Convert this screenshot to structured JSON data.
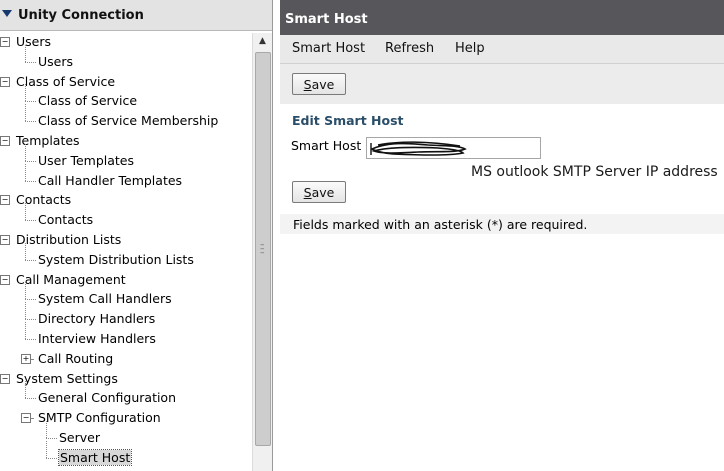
{
  "nav": {
    "title": "Unity Connection",
    "tree": [
      {
        "label": "Users",
        "level": 0,
        "expander": "-"
      },
      {
        "label": "Users",
        "level": 1
      },
      {
        "label": "Class of Service",
        "level": 0,
        "expander": "-"
      },
      {
        "label": "Class of Service",
        "level": 1
      },
      {
        "label": "Class of Service Membership",
        "level": 1
      },
      {
        "label": "Templates",
        "level": 0,
        "expander": "-"
      },
      {
        "label": "User Templates",
        "level": 1
      },
      {
        "label": "Call Handler Templates",
        "level": 1
      },
      {
        "label": "Contacts",
        "level": 0,
        "expander": "-"
      },
      {
        "label": "Contacts",
        "level": 1
      },
      {
        "label": "Distribution Lists",
        "level": 0,
        "expander": "-"
      },
      {
        "label": "System Distribution Lists",
        "level": 1
      },
      {
        "label": "Call Management",
        "level": 0,
        "expander": "-"
      },
      {
        "label": "System Call Handlers",
        "level": 1
      },
      {
        "label": "Directory Handlers",
        "level": 1
      },
      {
        "label": "Interview Handlers",
        "level": 1
      },
      {
        "label": "Call Routing",
        "level": 1,
        "expander": "+"
      },
      {
        "label": "System Settings",
        "level": 0,
        "expander": "-"
      },
      {
        "label": "General Configuration",
        "level": 1
      },
      {
        "label": "SMTP Configuration",
        "level": 1,
        "expander": "-"
      },
      {
        "label": "Server",
        "level": 2
      },
      {
        "label": "Smart Host",
        "level": 2,
        "selected": true
      }
    ]
  },
  "page": {
    "title": "Smart Host",
    "menu": [
      "Smart Host",
      "Refresh",
      "Help"
    ],
    "save_label_pre": "",
    "save_label_u": "S",
    "save_label_post": "ave",
    "section_title": "Edit Smart Host",
    "field_label": "Smart Host",
    "field_value": "",
    "annotation": "MS outlook SMTP Server IP address",
    "required_note": "Fields marked with an asterisk (*) are required."
  },
  "colors": {
    "header_bg": "#57565a",
    "section_title": "#2a4d68",
    "nav_header_bg": "#e3e3e3"
  }
}
